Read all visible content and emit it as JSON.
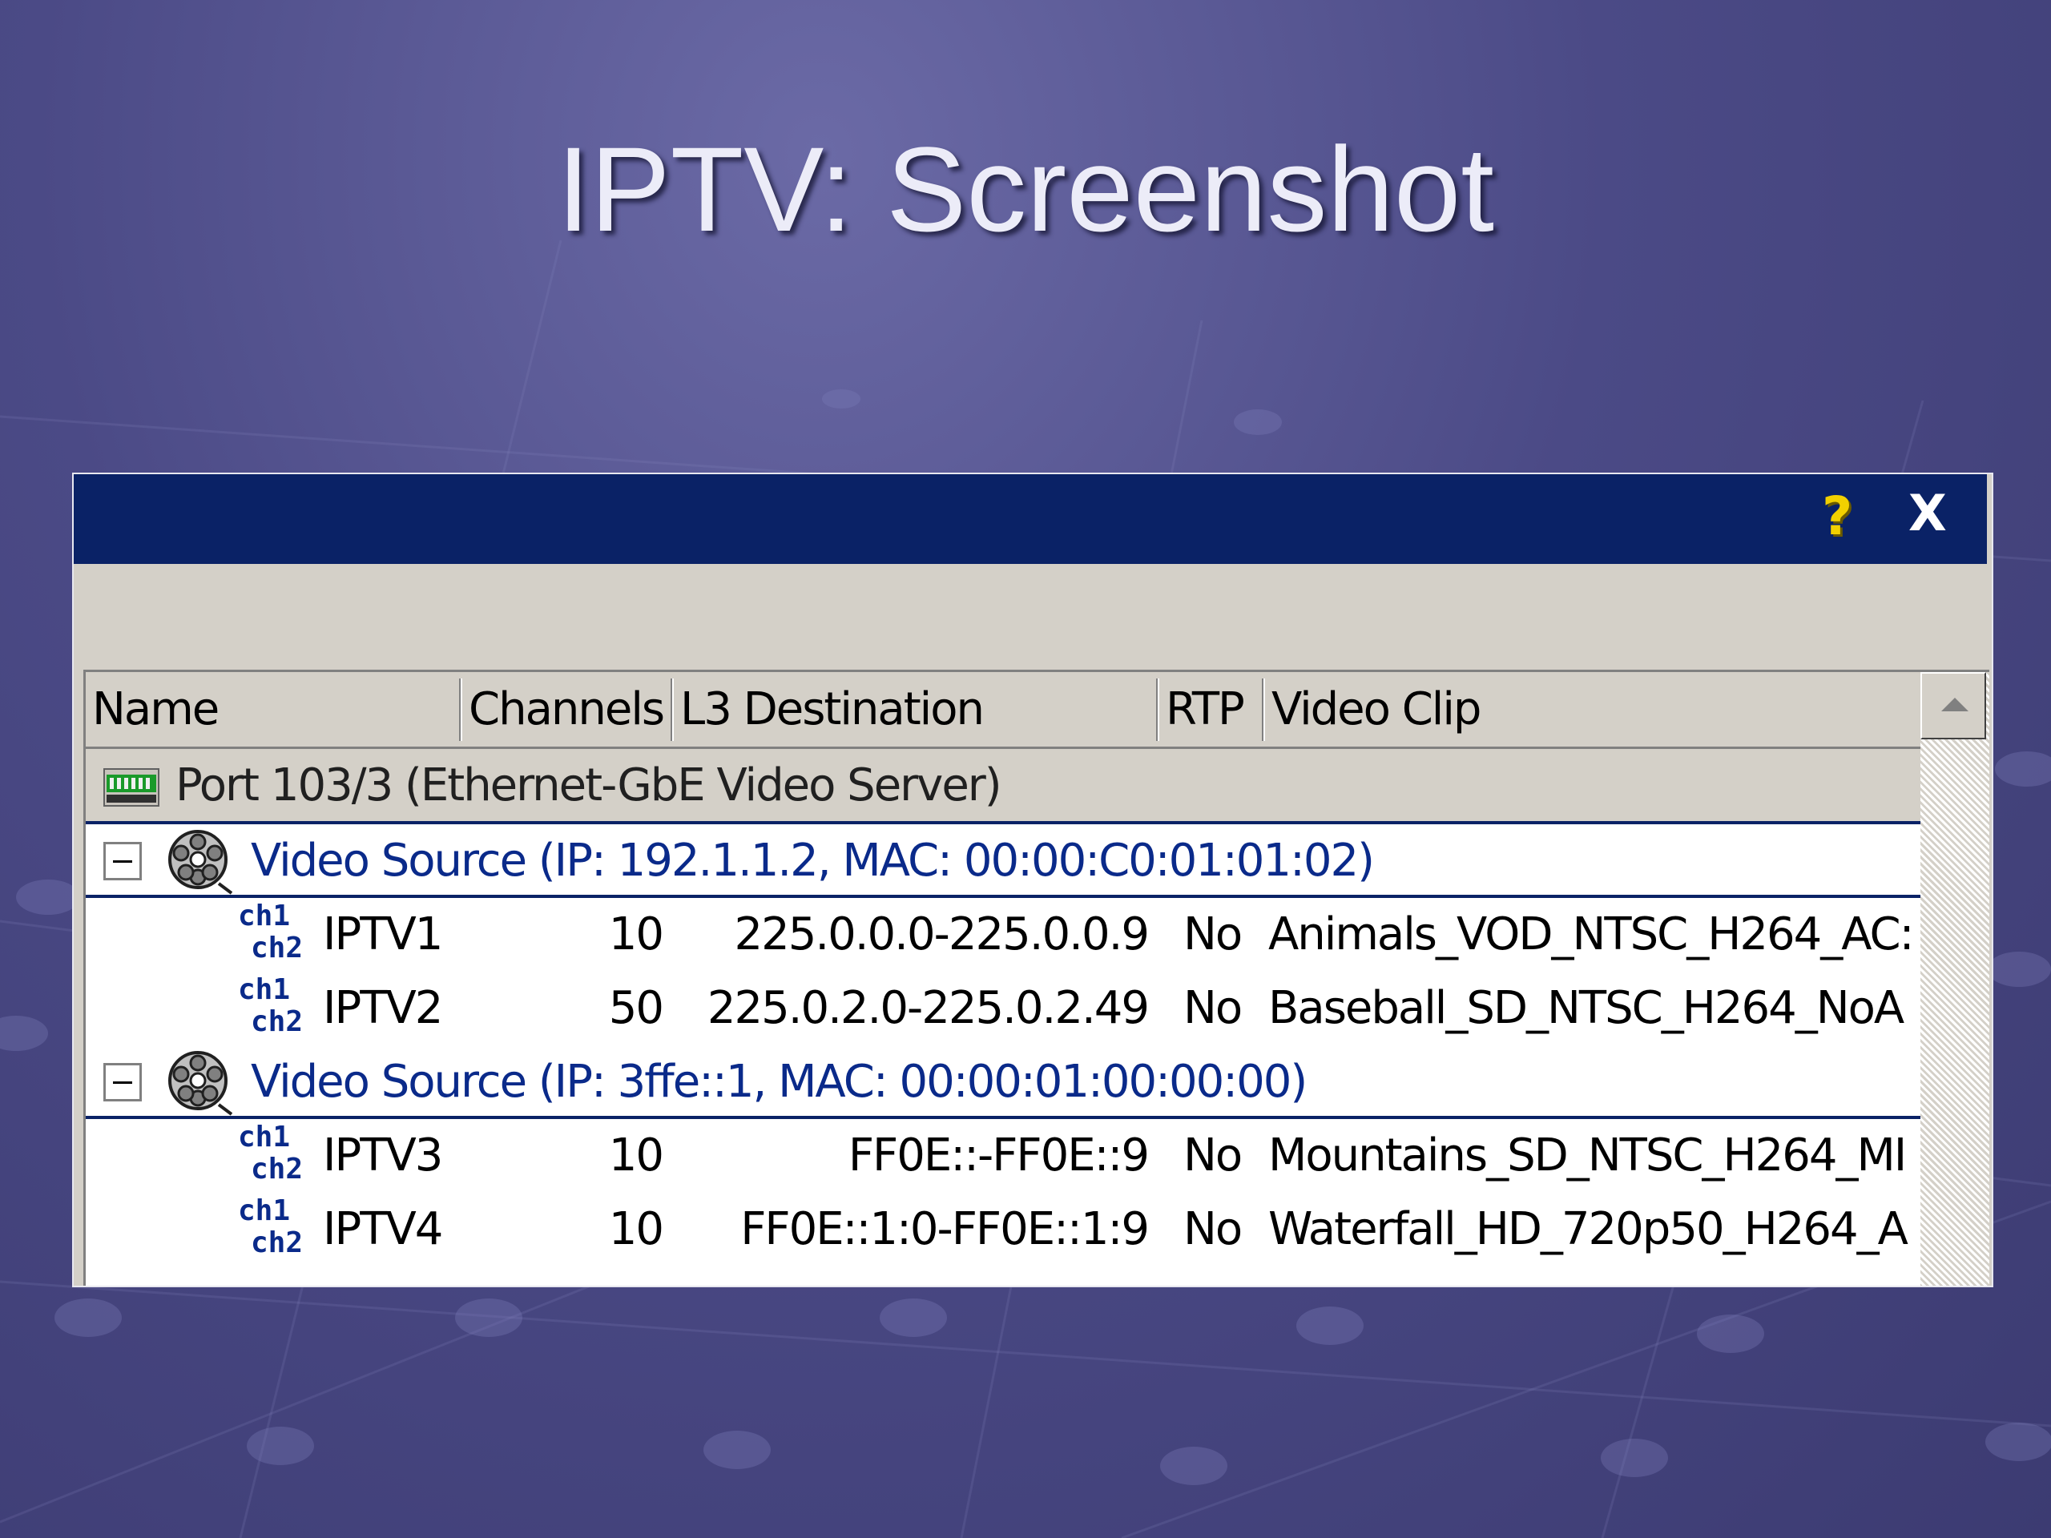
{
  "slide": {
    "title": "IPTV: Screenshot"
  },
  "window": {
    "help_label": "?",
    "close_label": "X"
  },
  "columns": [
    "Name",
    "Channels",
    "L3 Destination",
    "RTP",
    "Video Clip"
  ],
  "port": {
    "label": "Port 103/3 (Ethernet-GbE Video Server)",
    "icon": "network-port-icon"
  },
  "sources": [
    {
      "label": "Video Source  (IP: 192.1.1.2, MAC: 00:00:C0:01:01:02)",
      "icon": "film-reel-icon",
      "streams": [
        {
          "name": "IPTV1",
          "channels": "10",
          "destination": "225.0.0.0-225.0.0.9",
          "rtp": "No",
          "clip": "Animals_VOD_NTSC_H264_AC:"
        },
        {
          "name": "IPTV2",
          "channels": "50",
          "destination": "225.0.2.0-225.0.2.49",
          "rtp": "No",
          "clip": "Baseball_SD_NTSC_H264_NoA"
        }
      ]
    },
    {
      "label": "Video Source  (IP: 3ffe::1, MAC: 00:00:01:00:00:00)",
      "icon": "film-reel-icon",
      "streams": [
        {
          "name": "IPTV3",
          "channels": "10",
          "destination": "FF0E::-FF0E::9",
          "rtp": "No",
          "clip": "Mountains_SD_NTSC_H264_MI"
        },
        {
          "name": "IPTV4",
          "channels": "10",
          "destination": "FF0E::1:0-FF0E::1:9",
          "rtp": "No",
          "clip": "Waterfall_HD_720p50_H264_A"
        }
      ]
    }
  ],
  "channel_icon": {
    "line1": "ch1",
    "line2": "ch2"
  }
}
